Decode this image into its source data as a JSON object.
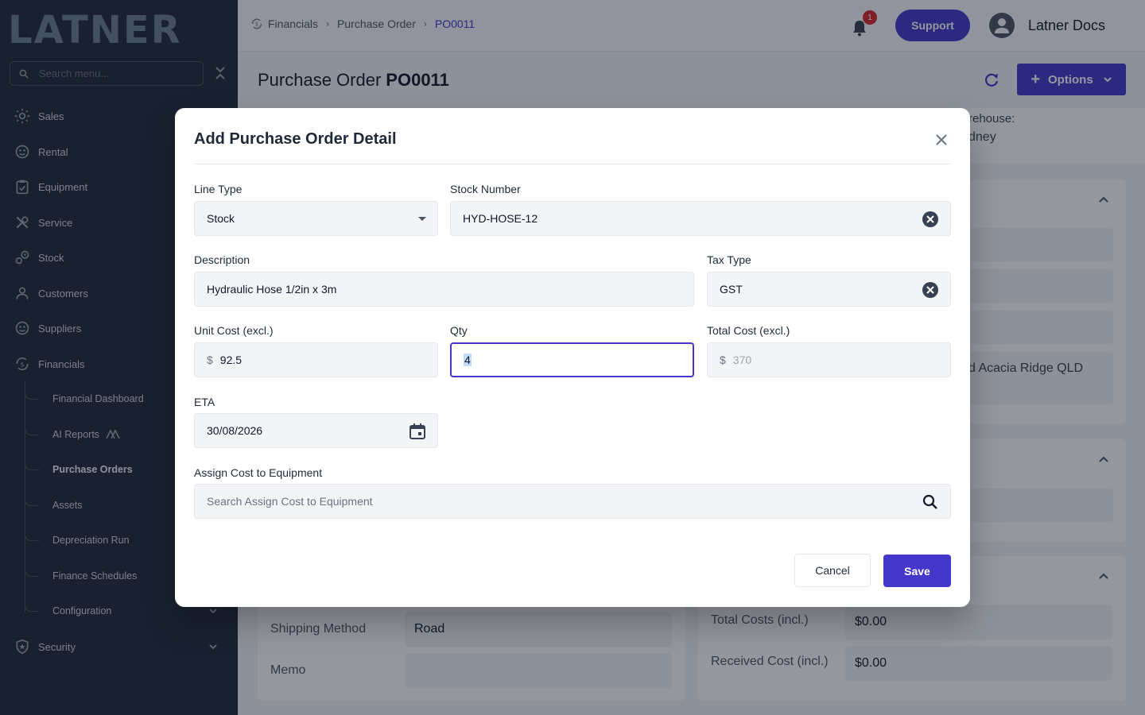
{
  "brand": {
    "logo_text": "LATNER"
  },
  "sidebar": {
    "search_placeholder": "Search menu...",
    "items": [
      {
        "label": "Sales"
      },
      {
        "label": "Rental"
      },
      {
        "label": "Equipment"
      },
      {
        "label": "Service"
      },
      {
        "label": "Stock"
      },
      {
        "label": "Customers"
      },
      {
        "label": "Suppliers"
      },
      {
        "label": "Financials"
      },
      {
        "label": "Security"
      }
    ],
    "financials_children": [
      {
        "label": "Financial Dashboard"
      },
      {
        "label": "AI Reports"
      },
      {
        "label": "Purchase Orders"
      },
      {
        "label": "Assets"
      },
      {
        "label": "Depreciation Run"
      },
      {
        "label": "Finance Schedules"
      },
      {
        "label": "Configuration"
      }
    ]
  },
  "header": {
    "breadcrumb": [
      "Financials",
      "Purchase Order",
      "PO0011"
    ],
    "notification_count": "1",
    "support_label": "Support",
    "user_name": "Latner Docs"
  },
  "page": {
    "title_prefix": "Purchase Order",
    "title_id": "PO0011",
    "options_label": "Options",
    "warehouse_label": "rehouse:",
    "warehouse_value": "dney",
    "address_fragment": "d Acacia Ridge QLD",
    "shipping_method_label": "Shipping Method",
    "shipping_method_value": "Road",
    "memo_label": "Memo",
    "total_costs_label": "Total Costs (incl.)",
    "total_costs_value": "$0.00",
    "received_cost_label": "Received Cost (incl.)",
    "received_cost_value": "$0.00"
  },
  "modal": {
    "title": "Add Purchase Order Detail",
    "line_type": {
      "label": "Line Type",
      "value": "Stock"
    },
    "stock_number": {
      "label": "Stock Number",
      "value": "HYD-HOSE-12"
    },
    "description": {
      "label": "Description",
      "value": "Hydraulic Hose 1/2in x 3m"
    },
    "tax_type": {
      "label": "Tax Type",
      "value": "GST"
    },
    "unit_cost": {
      "label": "Unit Cost (excl.)",
      "currency": "$",
      "value": "92.5"
    },
    "qty": {
      "label": "Qty",
      "value": "4"
    },
    "total_cost": {
      "label": "Total Cost (excl.)",
      "currency": "$",
      "value": "370"
    },
    "eta": {
      "label": "ETA",
      "value": "30/08/2026"
    },
    "assign_cost": {
      "label": "Assign Cost to Equipment",
      "placeholder": "Search Assign Cost to Equipment"
    },
    "cancel_label": "Cancel",
    "save_label": "Save"
  },
  "colors": {
    "accent": "#4338ca",
    "sidebar_bg": "#1f2937",
    "badge": "#dc2626"
  }
}
